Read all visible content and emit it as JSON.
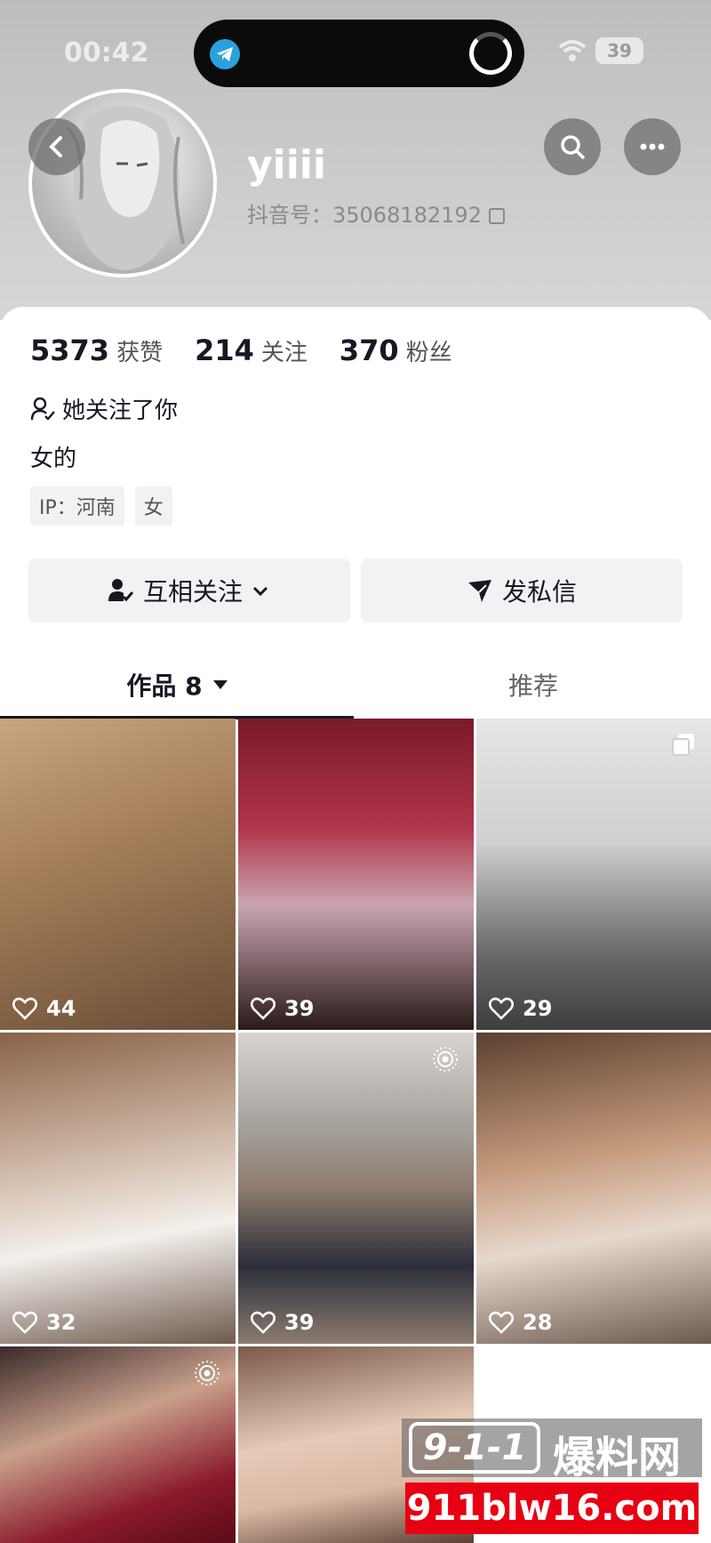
{
  "status_bar": {
    "time": "00:42",
    "battery": "39"
  },
  "profile": {
    "username": "yiiii",
    "douyin_id": "抖音号：35068182192"
  },
  "stats": [
    {
      "value": "5373",
      "label": "获赞"
    },
    {
      "value": "214",
      "label": "关注"
    },
    {
      "value": "370",
      "label": "粉丝"
    }
  ],
  "follows_you_text": "她关注了你",
  "bio": "女的",
  "tags": [
    "IP：河南",
    "女"
  ],
  "buttons": {
    "mutual": "互相关注",
    "message": "发私信"
  },
  "tabs": {
    "works": "作品 8",
    "recommend": "推荐"
  },
  "posts": [
    {
      "likes": "44",
      "corner_icon": ""
    },
    {
      "likes": "39",
      "corner_icon": ""
    },
    {
      "likes": "29",
      "corner_icon": "album-icon"
    },
    {
      "likes": "32",
      "corner_icon": ""
    },
    {
      "likes": "39",
      "corner_icon": "live-photo-icon"
    },
    {
      "likes": "28",
      "corner_icon": ""
    },
    {
      "likes": "",
      "corner_icon": "live-photo-icon"
    },
    {
      "likes": "",
      "corner_icon": ""
    }
  ],
  "watermark": {
    "logo": "9-1-1",
    "name": "爆料网",
    "url": "911blw16.com"
  },
  "colors": {
    "text": "#161823",
    "button_bg": "#f2f2f4",
    "watermark_red": "#e60012"
  }
}
